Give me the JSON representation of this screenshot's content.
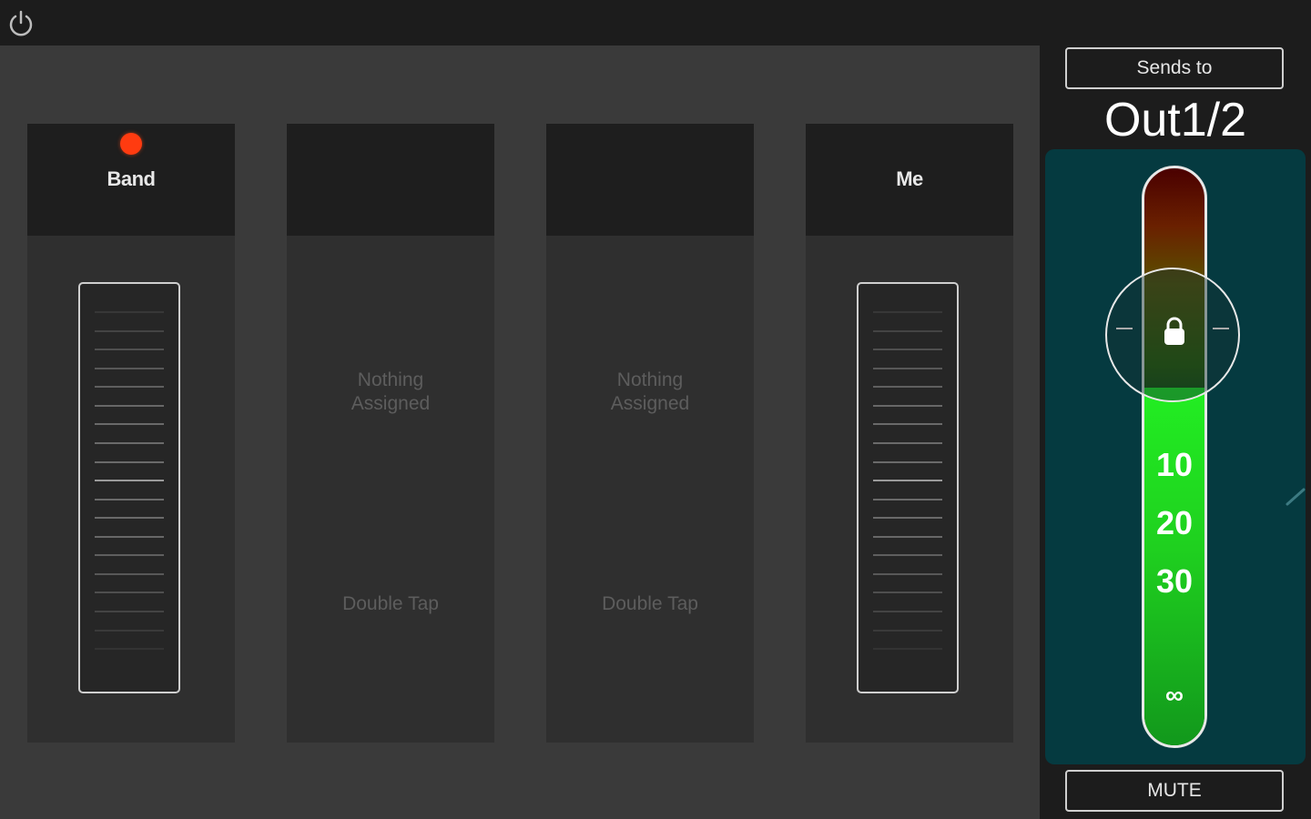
{
  "topbar": {
    "power_icon": "power-icon"
  },
  "channels": [
    {
      "name": "Band",
      "assigned": true,
      "indicator_color": "#ff3b10"
    },
    {
      "name": "",
      "assigned": false,
      "placeholder_line1": "Nothing",
      "placeholder_line2": "Assigned",
      "hint": "Double Tap"
    },
    {
      "name": "",
      "assigned": false,
      "placeholder_line1": "Nothing",
      "placeholder_line2": "Assigned",
      "hint": "Double Tap"
    },
    {
      "name": "Me",
      "assigned": true
    }
  ],
  "output": {
    "sends_label": "Sends to",
    "destination": "Out1/2",
    "meter_labels": [
      "10",
      "20",
      "30",
      "∞"
    ],
    "lock_icon": "lock-icon",
    "mute_label": "MUTE",
    "panel_color": "#053a40",
    "meter_color": "#22ee22"
  }
}
